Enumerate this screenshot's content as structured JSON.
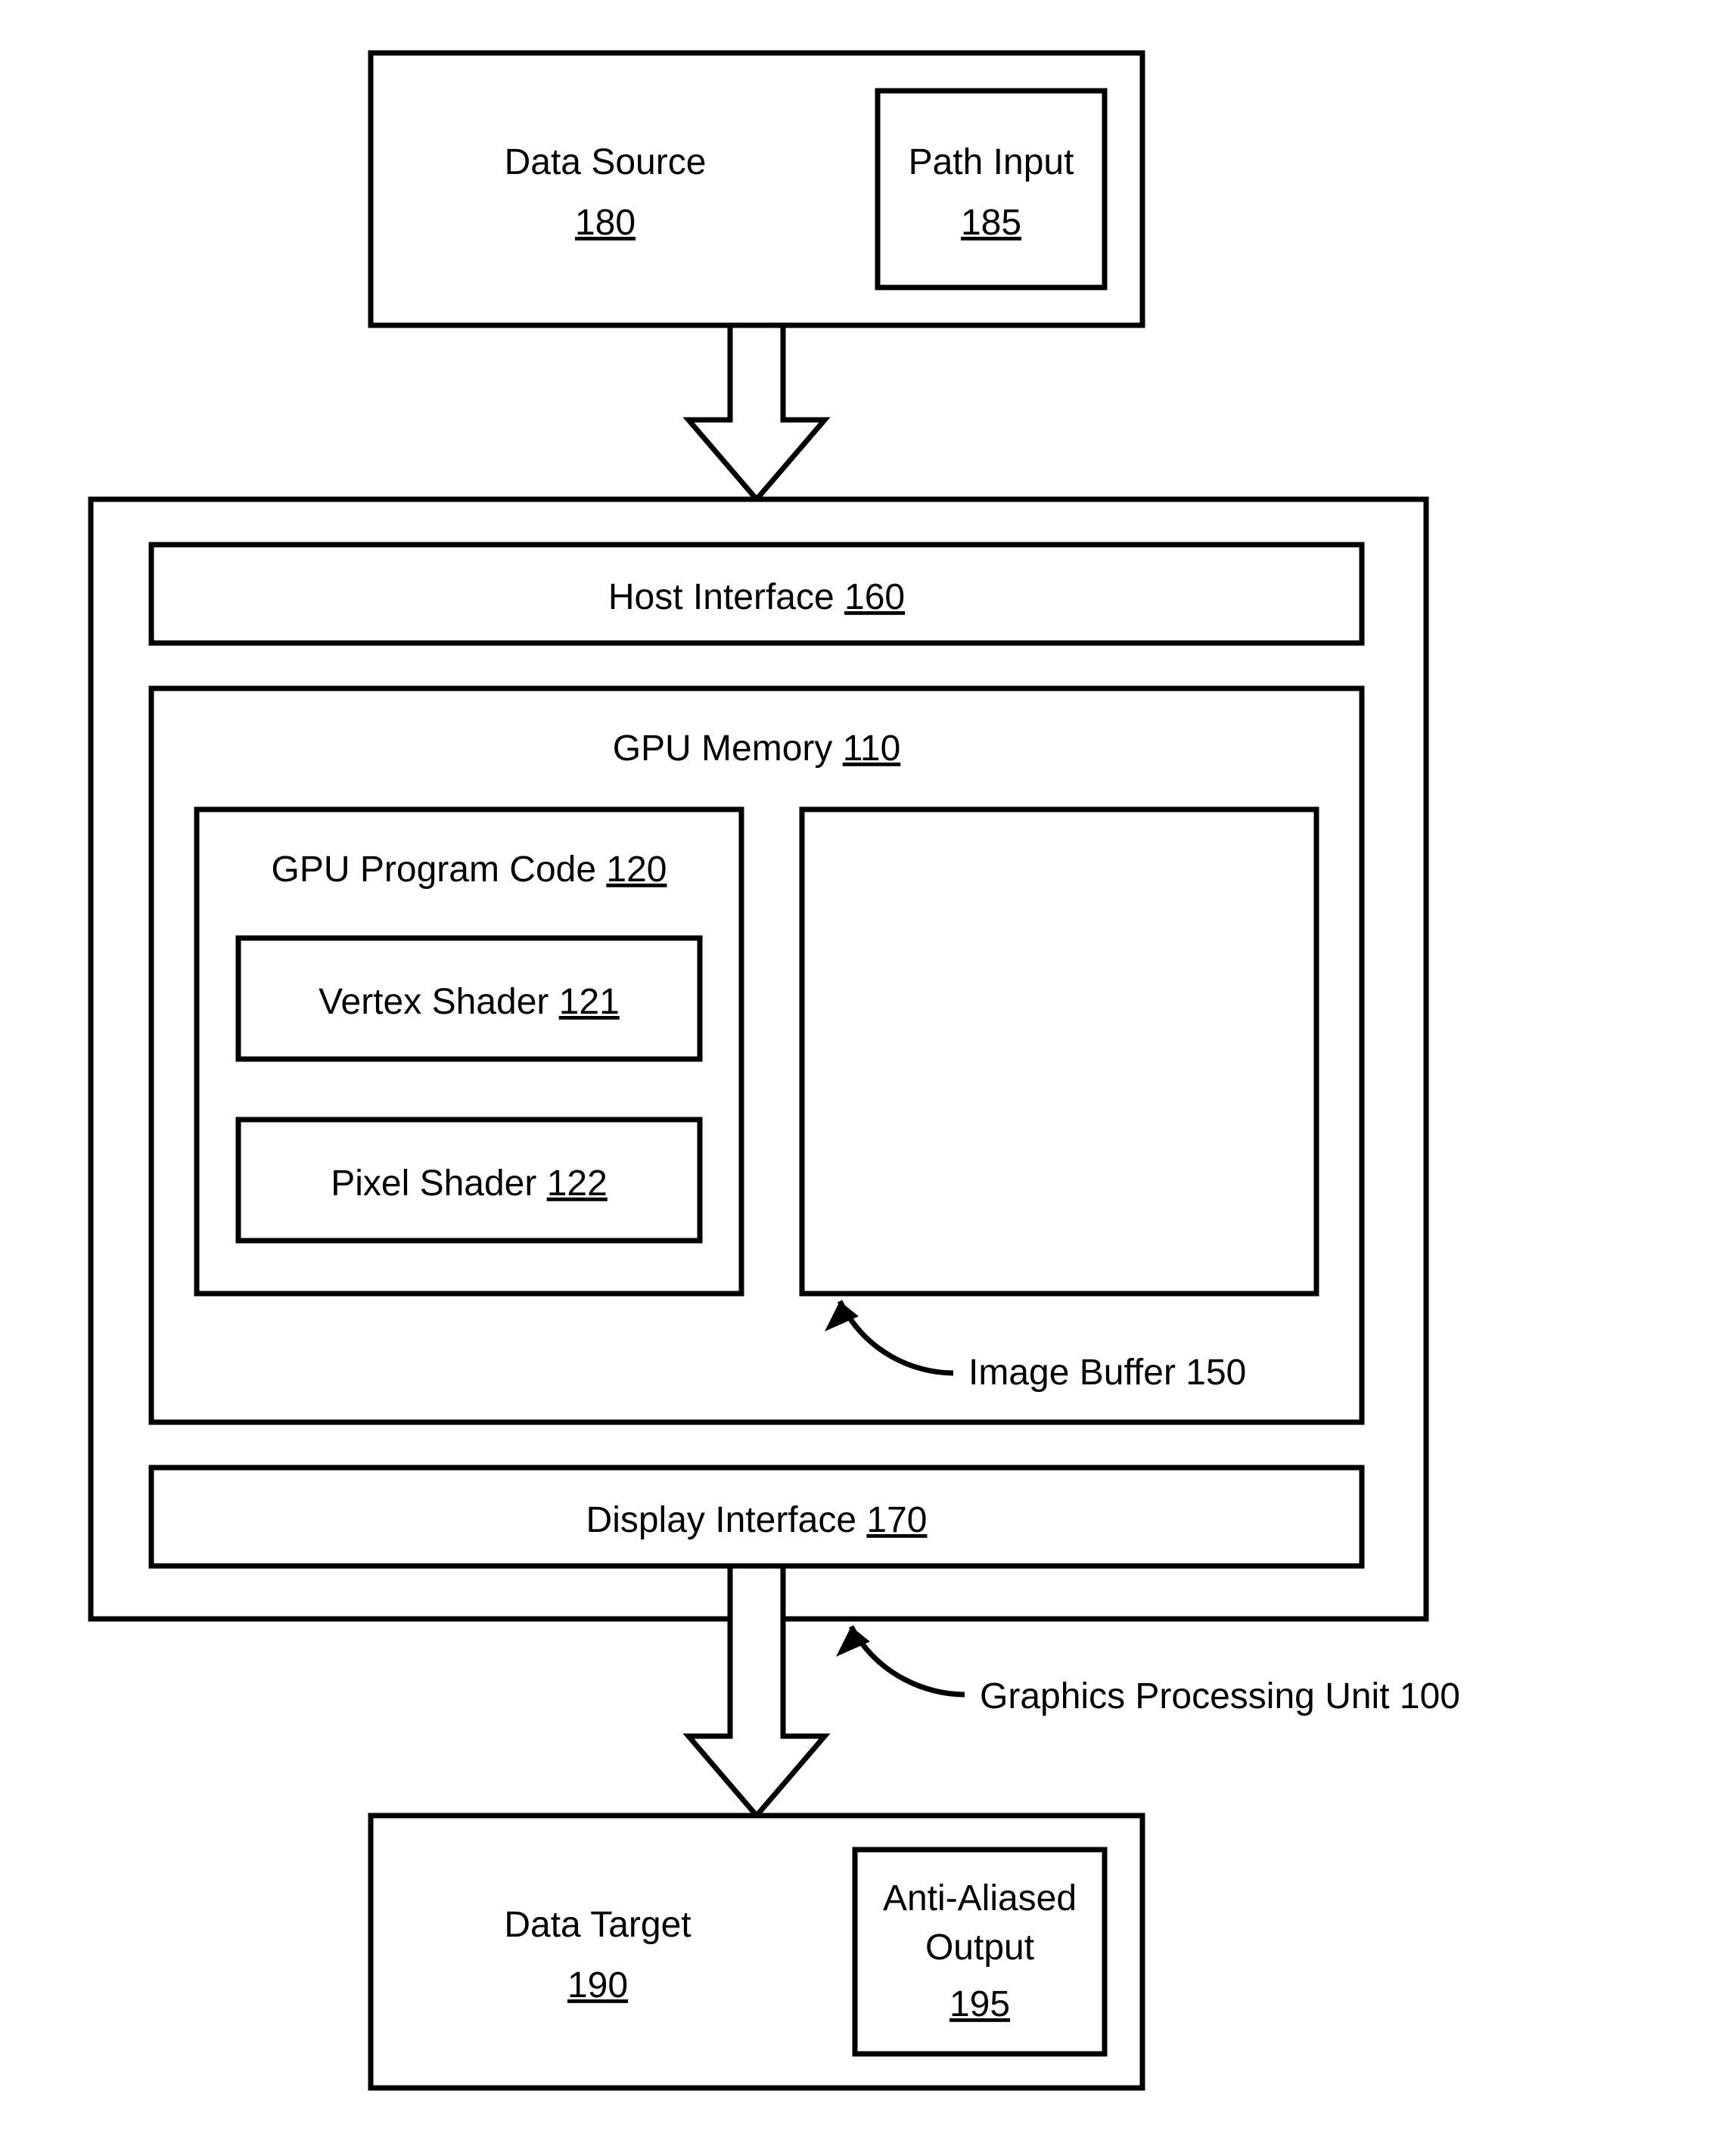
{
  "dataSource": {
    "label": "Data Source",
    "num": "180"
  },
  "pathInput": {
    "label": "Path Input",
    "num": "185"
  },
  "hostInterface": {
    "label": "Host Interface",
    "num": "160"
  },
  "gpuMemory": {
    "label": "GPU Memory",
    "num": "110"
  },
  "gpuProgram": {
    "label": "GPU Program Code",
    "num": "120"
  },
  "vertexShader": {
    "label": "Vertex Shader",
    "num": "121"
  },
  "pixelShader": {
    "label": "Pixel Shader",
    "num": "122"
  },
  "imageBuffer": {
    "label": "Image Buffer 150"
  },
  "displayInterface": {
    "label": "Display Interface",
    "num": "170"
  },
  "gpuUnit": {
    "label": "Graphics Processing Unit 100"
  },
  "dataTarget": {
    "label": "Data Target",
    "num": "190"
  },
  "aaOutput": {
    "label1": "Anti-Aliased",
    "label2": "Output",
    "num": "195"
  }
}
